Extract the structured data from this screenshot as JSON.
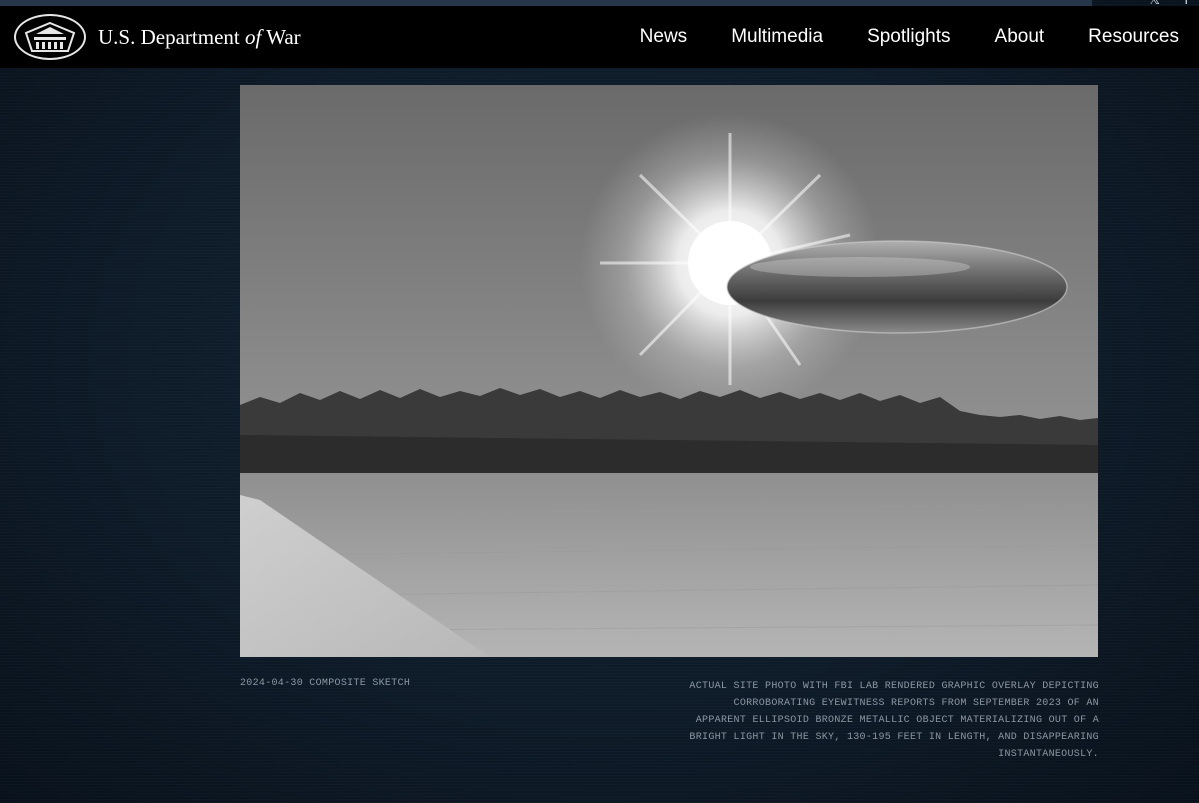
{
  "header": {
    "brand_prefix": "U.S. Department",
    "brand_italic": "of",
    "brand_suffix": "War",
    "seal_icon": "pentagon-seal-icon",
    "nav": [
      {
        "label": "News"
      },
      {
        "label": "Multimedia"
      },
      {
        "label": "Spotlights"
      },
      {
        "label": "About"
      },
      {
        "label": "Resources"
      }
    ],
    "social": [
      {
        "icon": "x-icon",
        "glyph": "𝕏"
      },
      {
        "icon": "facebook-icon",
        "glyph": "f"
      }
    ]
  },
  "photo": {
    "description_icon": "composite-ufo-photo"
  },
  "caption": {
    "label": "2024-04-30 COMPOSITE SKETCH",
    "text": "ACTUAL SITE PHOTO WITH FBI LAB RENDERED GRAPHIC OVERLAY DEPICTING CORROBORATING EYEWITNESS REPORTS FROM SEPTEMBER 2023 OF AN APPARENT ELLIPSOID BRONZE METALLIC OBJECT MATERIALIZING OUT OF A BRIGHT LIGHT IN THE SKY, 130-195 FEET IN LENGTH, AND DISAPPEARING INSTANTANEOUSLY."
  },
  "colors": {
    "background": "#0c1622",
    "header": "#000000",
    "caption_text": "#8c97a3"
  }
}
